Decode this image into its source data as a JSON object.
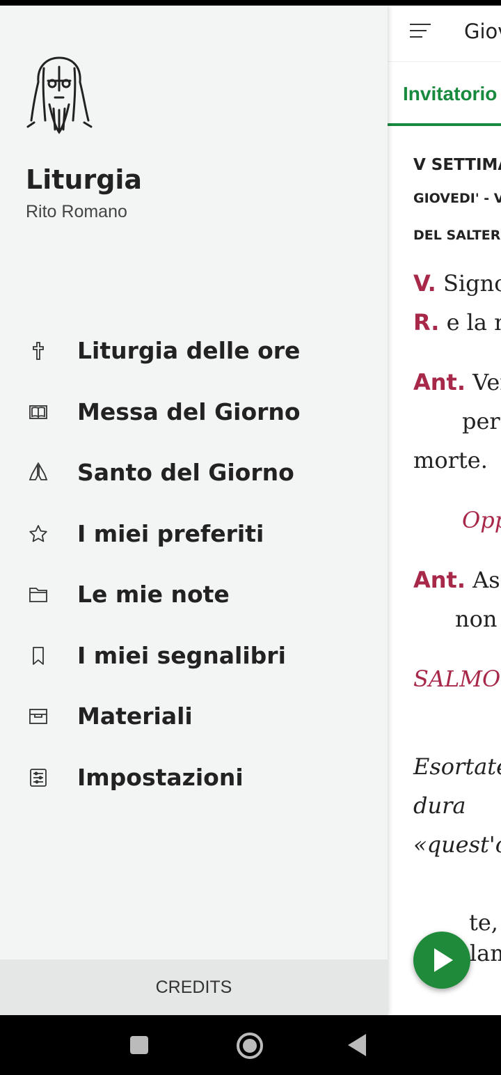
{
  "appbar": {
    "title": "Giov"
  },
  "tabs": [
    {
      "label": "Invitatorio"
    }
  ],
  "content": {
    "week": "V SETTIMA",
    "day": "GIOVEDI' - V",
    "psalter": "DEL SALTER",
    "v_mark": "V.",
    "v_text": " Signo",
    "r_mark": "R.",
    "r_text": " e la m",
    "ant1_mark": "Ant.",
    "ant1_text": " Ven",
    "ant1_cont": "per",
    "ant1_end": "morte.",
    "oppure": "Opp",
    "ant2_mark": "Ant.",
    "ant2_text": " Asc",
    "ant2_cont": "non",
    "salmo": "SALMO",
    "italic1": "Esortate",
    "italic2": "dura",
    "italic3": "«quest'o",
    "bottom1": "te, a",
    "bottom2": "acclam"
  },
  "drawer": {
    "app_name": "Liturgia",
    "app_subtitle": "Rito Romano",
    "items": [
      {
        "label": "Liturgia delle ore",
        "icon": "cross-icon"
      },
      {
        "label": "Messa del Giorno",
        "icon": "book-icon"
      },
      {
        "label": "Santo del Giorno",
        "icon": "praying-hands-icon"
      },
      {
        "label": "I miei preferiti",
        "icon": "star-icon"
      },
      {
        "label": "Le mie note",
        "icon": "folder-icon"
      },
      {
        "label": "I miei segnalibri",
        "icon": "bookmark-icon"
      },
      {
        "label": "Materiali",
        "icon": "archive-box-icon"
      },
      {
        "label": "Impostazioni",
        "icon": "settings-sliders-icon"
      }
    ],
    "credits": "CREDITS"
  },
  "colors": {
    "accent_green": "#178a3e",
    "rubric_red": "#a8284a",
    "drawer_bg": "#f3f4f4"
  }
}
